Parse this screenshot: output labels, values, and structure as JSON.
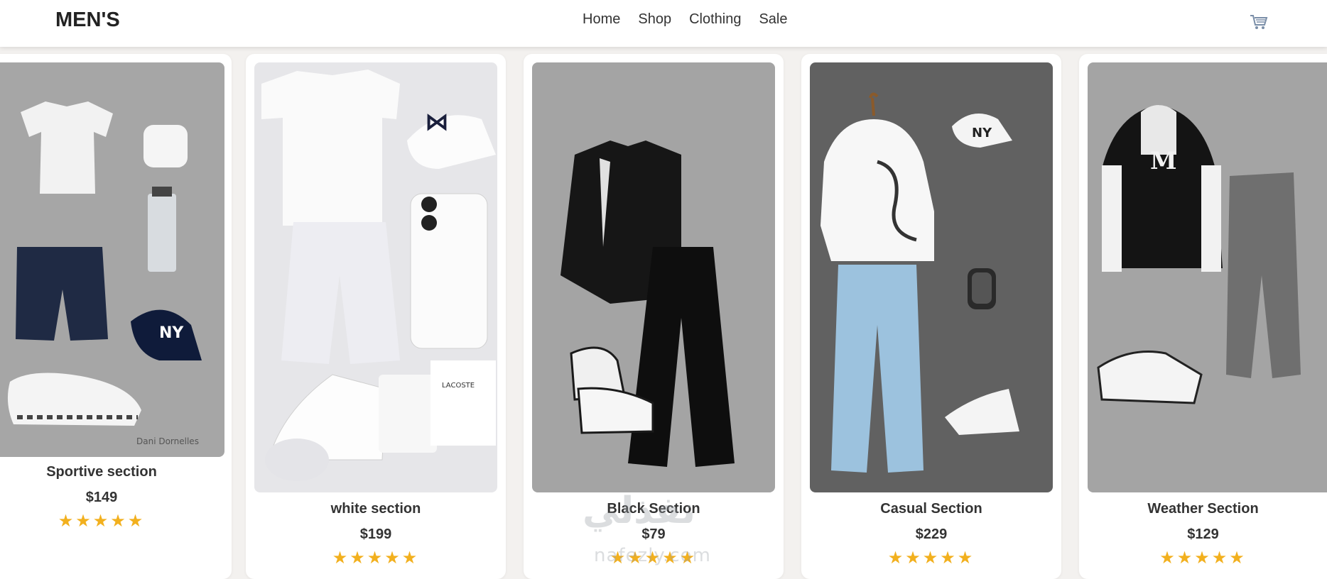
{
  "header": {
    "brand": "MEN'S",
    "nav": [
      "Home",
      "Shop",
      "Clothing",
      "Sale"
    ],
    "cart_icon": "cart-icon"
  },
  "products": [
    {
      "title": "Sportive section",
      "price": "$149",
      "rating": 5,
      "bg": "#a6a6a6",
      "image_caption": "Dani Dornelles",
      "items": [
        "white t-shirt",
        "airpods",
        "perfume bottle",
        "navy shorts",
        "NY cap",
        "white running shoes"
      ]
    },
    {
      "title": "white section",
      "price": "$199",
      "rating": 5,
      "bg": "#e6e6e9",
      "image_caption": "LACOSTE",
      "items": [
        "white t-shirt",
        "Under Armour cap",
        "white smartphone",
        "white shorts",
        "white sneakers",
        "Lacoste perfume"
      ]
    },
    {
      "title": "Black Section",
      "price": "$79",
      "rating": 5,
      "bg": "#a4a4a4",
      "items": [
        "black jacket",
        "black trousers",
        "high-top sneakers"
      ]
    },
    {
      "title": "Casual Section",
      "price": "$229",
      "rating": 5,
      "bg": "#616161",
      "items": [
        "white dragon hoodie",
        "NY cap",
        "smartwatch",
        "light blue jeans",
        "white sneakers"
      ]
    },
    {
      "title": "Weather Section",
      "price": "$129",
      "rating": 5,
      "bg": "#a4a4a4",
      "items": [
        "varsity jacket",
        "grey baggy jeans",
        "white sneakers"
      ]
    }
  ],
  "star_glyph": "★",
  "watermark": {
    "arabic": "نفذلي",
    "latin": "nafezly.com"
  },
  "colors": {
    "star": "#f2b01e",
    "text": "#333333",
    "page_bg": "#f3f1ef"
  }
}
